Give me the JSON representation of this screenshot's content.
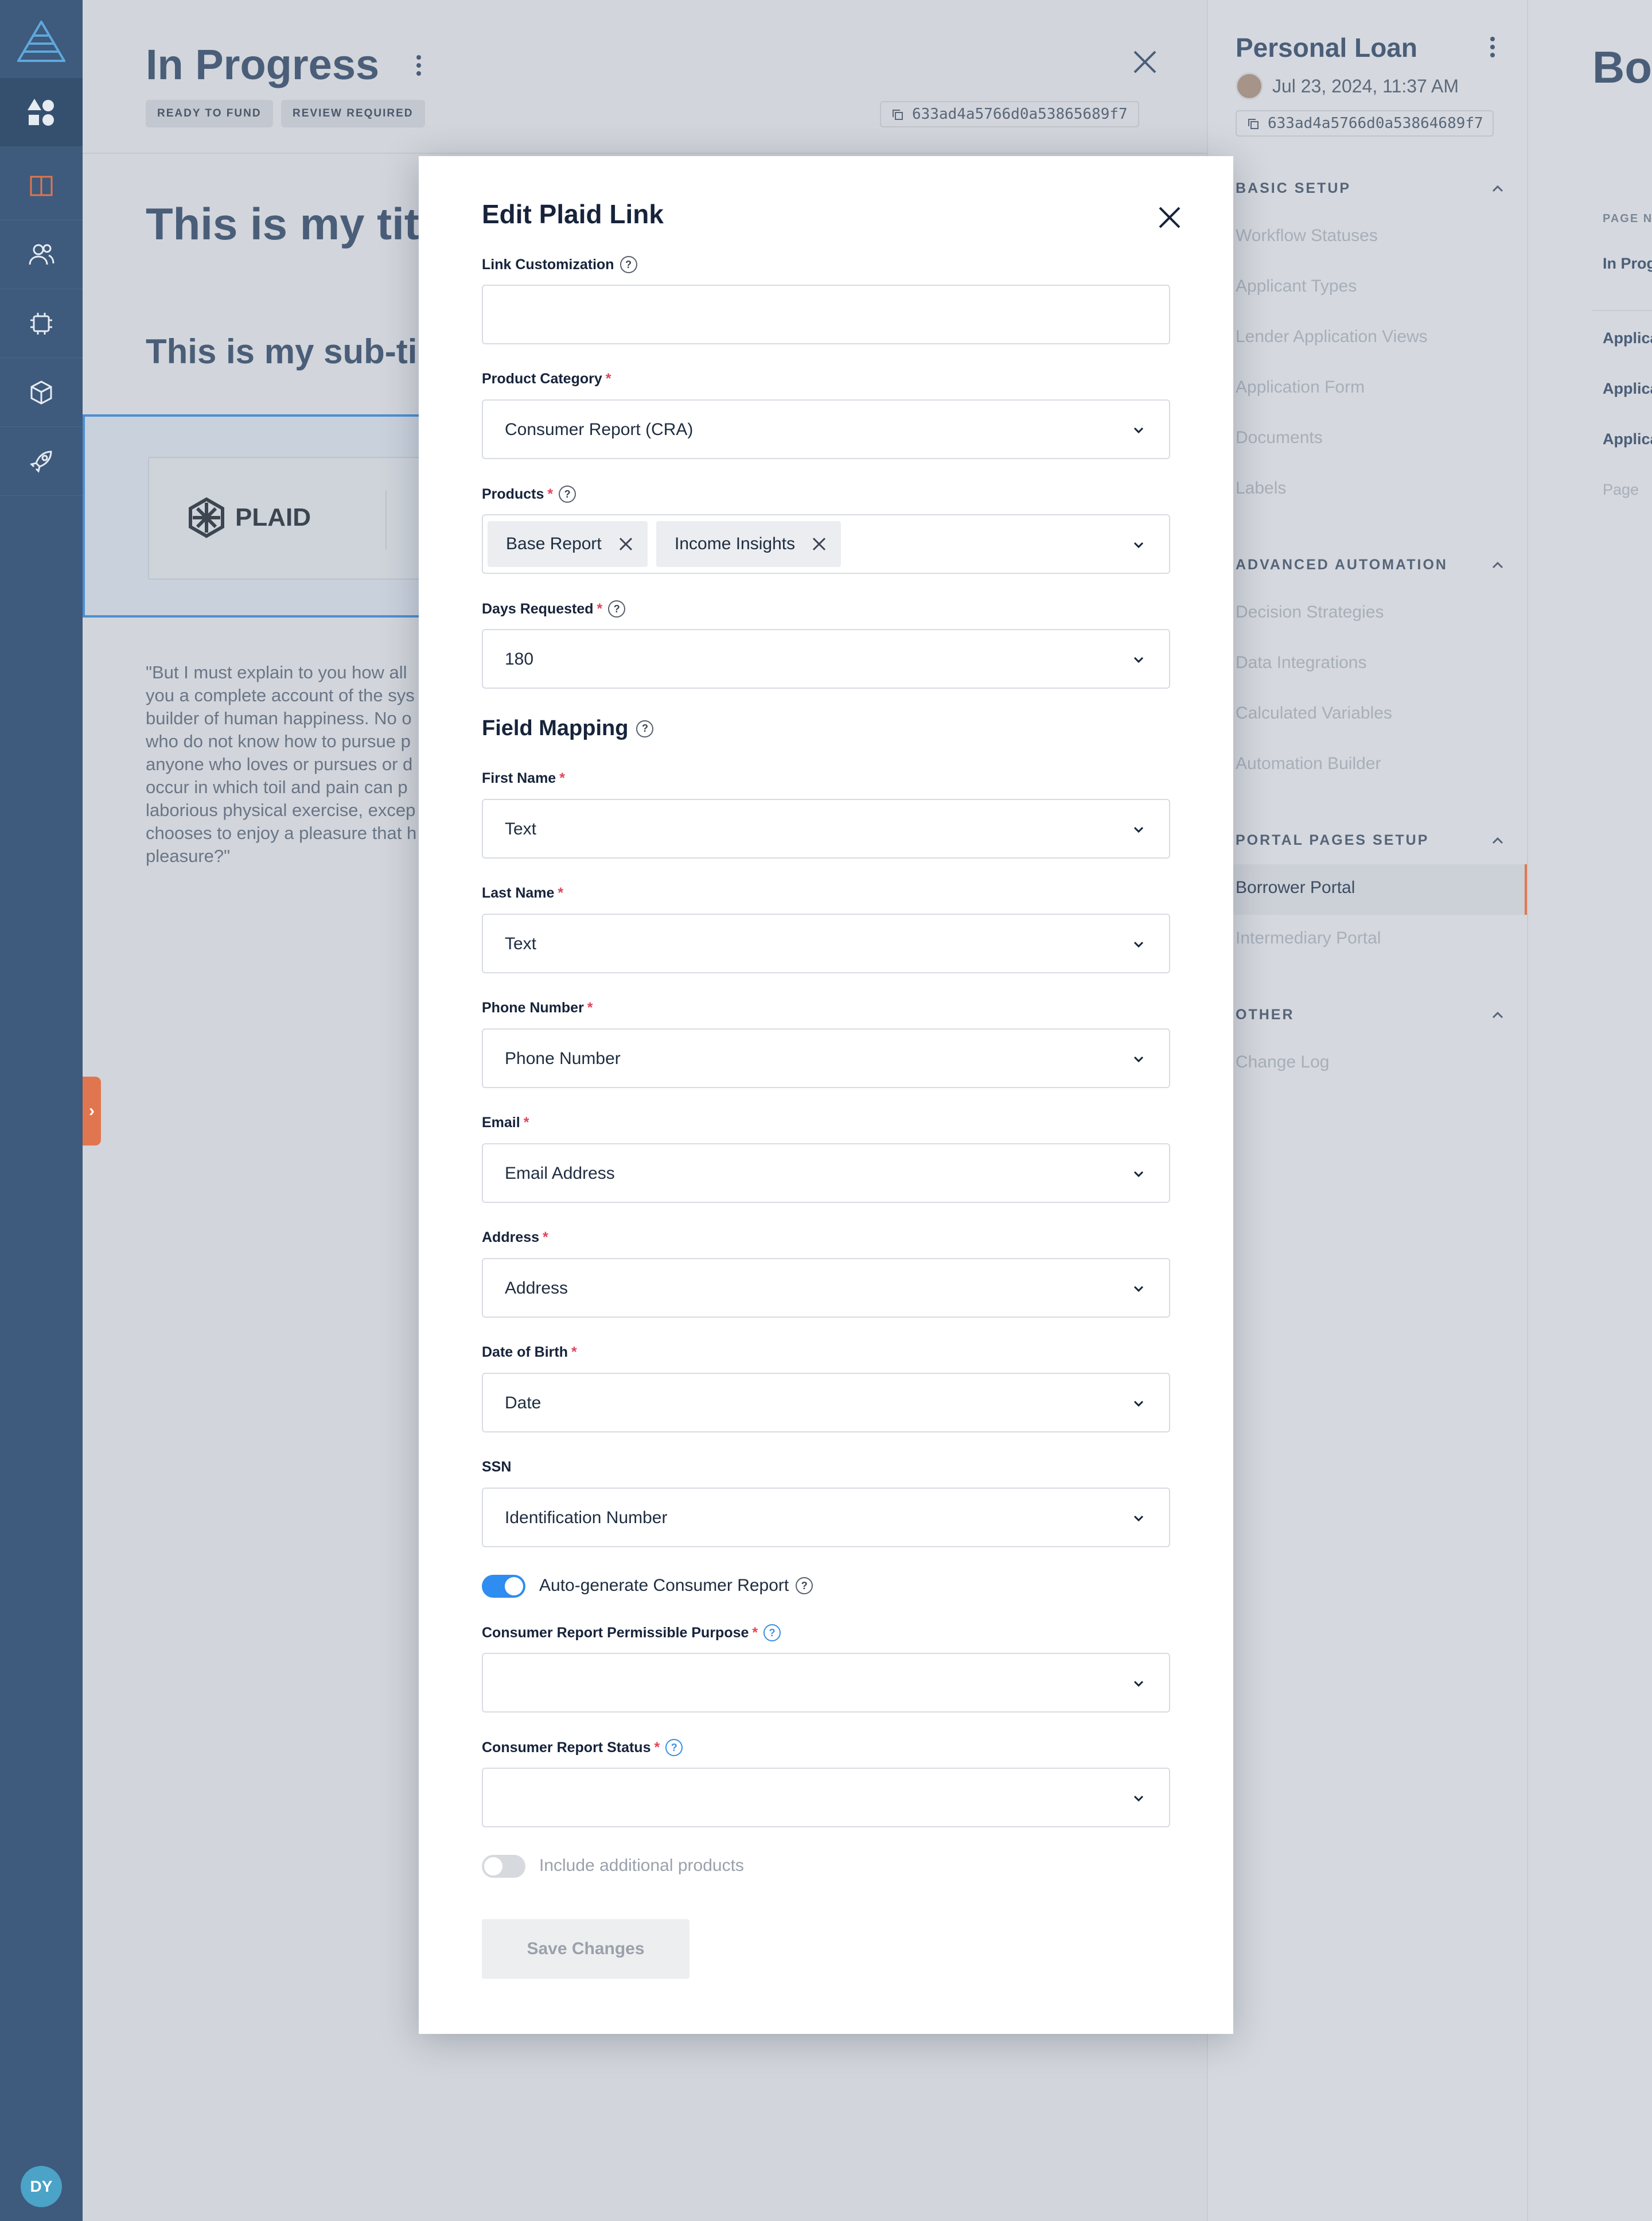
{
  "nav": {
    "items": [
      "apps-icon",
      "book-icon",
      "users-icon",
      "chip-icon",
      "box-icon",
      "rocket-icon"
    ],
    "avatar_initials": "DY"
  },
  "background": {
    "title": "In Progress",
    "badges": [
      "READY TO FUND",
      "REVIEW REQUIRED"
    ],
    "record_id": "633ad4a5766d0a53865689f7",
    "page_title": "This is my tit",
    "page_subtitle": "This is my sub-ti",
    "plaid_logo_text": "PLAID",
    "body_text": "\"But I must explain to you how all\nyou a complete account of the sys\nbuilder of human happiness. No o\nwho do not know how to pursue p\nanyone who loves or pursues or d\noccur in which toil and pain can p\nlaborious physical exercise, excep\nchooses to enjoy a pleasure that h\npleasure?\""
  },
  "config_panel": {
    "title": "Personal Loan",
    "date": "Jul 23, 2024, 11:37 AM",
    "record_id": "633ad4a5766d0a53864689f7",
    "sections": [
      {
        "title": "BASIC SETUP",
        "items": [
          "Workflow Statuses",
          "Applicant Types",
          "Lender Application Views",
          "Application Form",
          "Documents",
          "Labels"
        ]
      },
      {
        "title": "ADVANCED AUTOMATION",
        "items": [
          "Decision Strategies",
          "Data Integrations",
          "Calculated Variables",
          "Automation Builder"
        ]
      },
      {
        "title": "PORTAL PAGES SETUP",
        "items": [
          "Borrower Portal",
          "Intermediary Portal"
        ]
      },
      {
        "title": "OTHER",
        "items": [
          "Change Log"
        ]
      }
    ]
  },
  "far_panel": {
    "title": "Bo",
    "column_label": "PAGE NA",
    "rows": [
      "In Prog",
      "Applica",
      "Applica",
      "Applica",
      "Page"
    ]
  },
  "modal": {
    "title": "Edit Plaid Link",
    "link_customization": {
      "label": "Link Customization",
      "value": ""
    },
    "product_category": {
      "label": "Product Category",
      "value": "Consumer Report (CRA)"
    },
    "products": {
      "label": "Products",
      "chips": [
        "Base Report",
        "Income Insights"
      ]
    },
    "days_requested": {
      "label": "Days Requested",
      "value": "180"
    },
    "field_mapping_title": "Field Mapping",
    "mapping": [
      {
        "label": "First Name",
        "value": "Text",
        "required": true
      },
      {
        "label": "Last Name",
        "value": "Text",
        "required": true
      },
      {
        "label": "Phone Number",
        "value": "Phone Number",
        "required": true
      },
      {
        "label": "Email",
        "value": "Email Address",
        "required": true
      },
      {
        "label": "Address",
        "value": "Address",
        "required": true
      },
      {
        "label": "Date of Birth",
        "value": "Date",
        "required": true
      },
      {
        "label": "SSN",
        "value": "Identification Number",
        "required": false
      }
    ],
    "auto_generate": {
      "label": "Auto-generate Consumer Report",
      "on": true
    },
    "permissible_purpose": {
      "label": "Consumer Report Permissible Purpose",
      "value": ""
    },
    "report_status": {
      "label": "Consumer Report Status",
      "value": ""
    },
    "include_additional": {
      "label": "Include additional products",
      "on": false
    },
    "save_label": "Save Changes",
    "required_mark": "*",
    "help_mark": "?"
  },
  "colors": {
    "nav_bg": "#3e5a7c",
    "accent_orange": "#e0764f",
    "toggle_on": "#2f8cf0",
    "toggle_off": "#d6d9de",
    "required": "#e0455b"
  }
}
